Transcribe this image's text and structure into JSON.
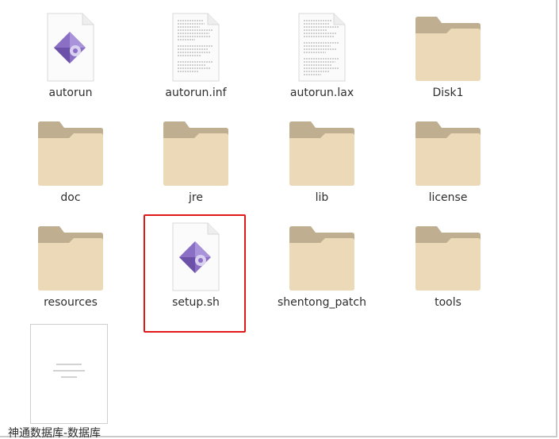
{
  "files": [
    {
      "name": "autorun",
      "icon": "script-icon"
    },
    {
      "name": "autorun.inf",
      "icon": "text-file-icon"
    },
    {
      "name": "autorun.lax",
      "icon": "text-file-icon"
    },
    {
      "name": "Disk1",
      "icon": "folder-icon"
    },
    {
      "name": "doc",
      "icon": "folder-icon"
    },
    {
      "name": "jre",
      "icon": "folder-icon"
    },
    {
      "name": "lib",
      "icon": "folder-icon"
    },
    {
      "name": "license",
      "icon": "folder-icon"
    },
    {
      "name": "resources",
      "icon": "folder-icon"
    },
    {
      "name": "setup.sh",
      "icon": "script-icon",
      "selected": true
    },
    {
      "name": "shentong_patch",
      "icon": "folder-icon"
    },
    {
      "name": "tools",
      "icon": "folder-icon"
    },
    {
      "name": "神通数据库-数据库",
      "icon": "document-preview-icon"
    }
  ],
  "colors": {
    "folder_back": "#bfae8f",
    "folder_front": "#ecd9b8",
    "selection": "#e01919",
    "script_purple": "#8a6fc4"
  }
}
